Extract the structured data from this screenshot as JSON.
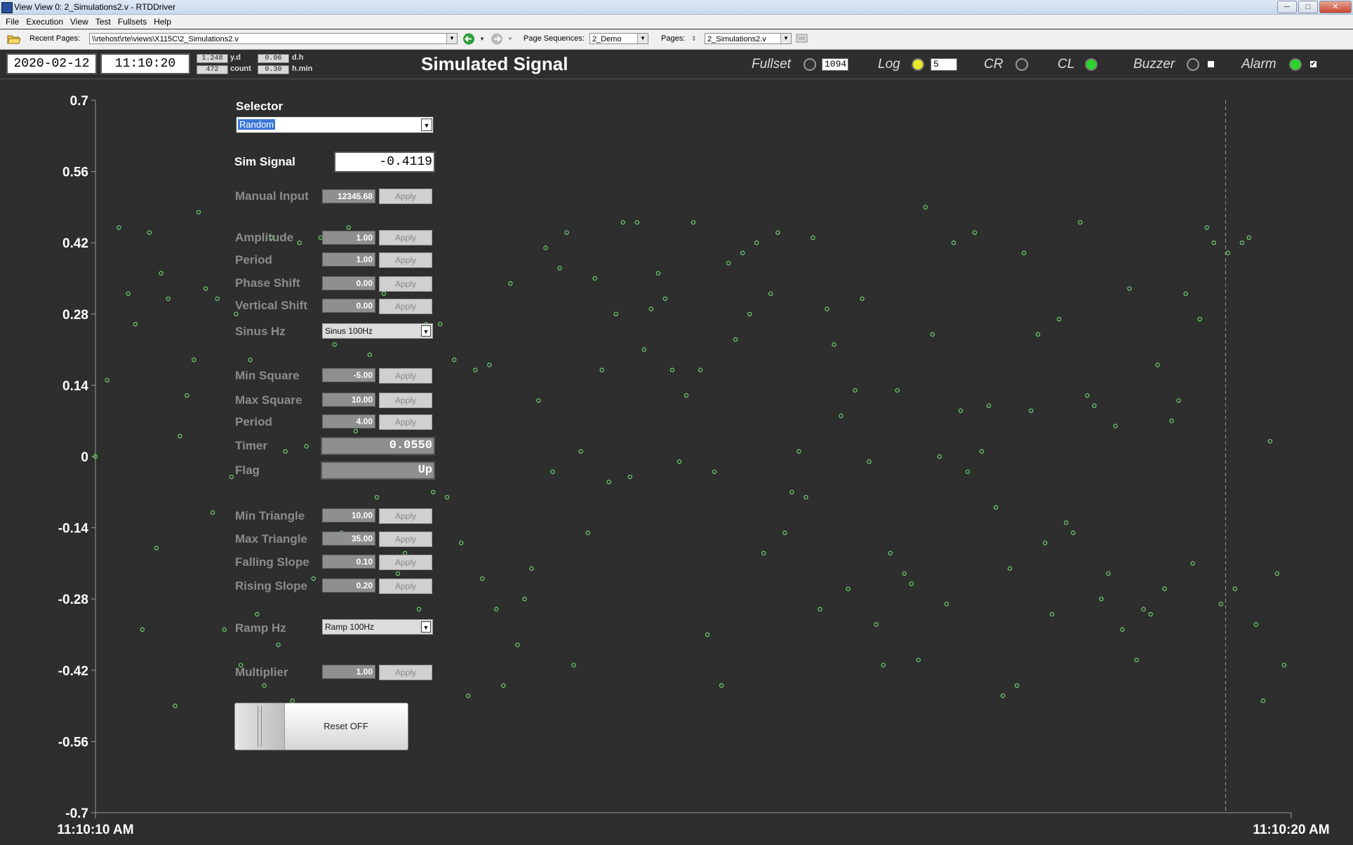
{
  "window": {
    "title": "View View 0: 2_Simulations2.v - RTDDriver",
    "buttons": [
      "─",
      "□",
      "✕"
    ]
  },
  "menubar": {
    "items": [
      "File",
      "Execution",
      "View",
      "Test",
      "Fullsets",
      "Help"
    ]
  },
  "toolbar": {
    "recent_pages_label": "Recent Pages:",
    "recent_pages_value": "\\\\rtehost\\rte\\views\\X115C\\2_Simulations2.v",
    "page_sequences_label": "Page Sequences:",
    "page_sequences_value": "2_Demo",
    "pages_label": "Pages:",
    "pages_value": "2_Simulations2.v"
  },
  "header": {
    "date": "2020-02-12",
    "time": "11:10:20",
    "yd_value": "1.248",
    "yd_label": "y.d",
    "count_value": "472",
    "count_label": "count",
    "dh_value": "0.06",
    "dh_label": "d.h",
    "hmin_value": "0.30",
    "hmin_label": "h.min",
    "title": "Simulated Signal",
    "fullset_label": "Fullset",
    "fullset_value": "1094",
    "log_label": "Log",
    "log_value": "5",
    "cr_label": "CR",
    "cl_label": "CL",
    "buzzer_label": "Buzzer",
    "alarm_label": "Alarm",
    "alarm_check": "✔",
    "colors": {
      "led_yellow": "#e8e82a",
      "led_green": "#2ad52a"
    }
  },
  "panel": {
    "selector_label": "Selector",
    "selector_value": "Random",
    "sim_signal_label": "Sim Signal",
    "sim_signal_value": "-0.4119",
    "manual_input_label": "Manual Input",
    "manual_input_value": "12345.68",
    "apply_label": "Apply",
    "amplitude_label": "Amplitude",
    "amplitude_value": "1.00",
    "period_label": "Period",
    "period_value": "1.00",
    "phase_shift_label": "Phase Shift",
    "phase_shift_value": "0.00",
    "vertical_shift_label": "Vertical Shift",
    "vertical_shift_value": "0.00",
    "sinus_hz_label": "Sinus Hz",
    "sinus_hz_value": "Sinus 100Hz",
    "min_square_label": "Min Square",
    "min_square_value": "-5.00",
    "max_square_label": "Max Square",
    "max_square_value": "10.00",
    "square_period_label": "Period",
    "square_period_value": "4.00",
    "timer_label": "Timer",
    "timer_value": "0.0550",
    "flag_label": "Flag",
    "flag_value": "Up",
    "min_triangle_label": "Min Triangle",
    "min_triangle_value": "10.00",
    "max_triangle_label": "Max Triangle",
    "max_triangle_value": "35.00",
    "falling_slope_label": "Falling Slope",
    "falling_slope_value": "0.10",
    "rising_slope_label": "Rising Slope",
    "rising_slope_value": "0.20",
    "ramp_hz_label": "Ramp Hz",
    "ramp_hz_value": "Ramp 100Hz",
    "multiplier_label": "Multiplier",
    "multiplier_value": "1.00",
    "reset_label": "Reset OFF"
  },
  "chart_data": {
    "type": "scatter",
    "title": "",
    "xlabel": "",
    "ylabel": "",
    "ylim": [
      -0.7,
      0.7
    ],
    "y_ticks": [
      "0.7",
      "0.56",
      "0.42",
      "0.28",
      "0.14",
      "0",
      "-0.14",
      "-0.28",
      "-0.42",
      "-0.56",
      "-0.7"
    ],
    "x_tick_labels": [
      "11:10:10 AM",
      "11:10:20 AM"
    ],
    "cursor_label": "",
    "marker_color": "#6fd46f",
    "series": [
      {
        "name": "",
        "points": [
          [
            0.0,
            0.0
          ],
          [
            0.05,
            0.15
          ],
          [
            0.1,
            0.45
          ],
          [
            0.14,
            0.32
          ],
          [
            0.17,
            0.26
          ],
          [
            0.2,
            -0.34
          ],
          [
            0.23,
            0.44
          ],
          [
            0.26,
            -0.18
          ],
          [
            0.28,
            0.36
          ],
          [
            0.31,
            0.31
          ],
          [
            0.34,
            -0.49
          ],
          [
            0.36,
            0.04
          ],
          [
            0.39,
            0.12
          ],
          [
            0.42,
            0.19
          ],
          [
            0.44,
            0.48
          ],
          [
            0.47,
            0.33
          ],
          [
            0.5,
            -0.11
          ],
          [
            0.52,
            0.31
          ],
          [
            0.55,
            -0.34
          ],
          [
            0.58,
            -0.04
          ],
          [
            0.6,
            0.28
          ],
          [
            0.62,
            -0.41
          ],
          [
            0.66,
            0.19
          ],
          [
            0.69,
            -0.31
          ],
          [
            0.72,
            -0.45
          ],
          [
            0.75,
            0.43
          ],
          [
            0.78,
            -0.37
          ],
          [
            0.81,
            0.01
          ],
          [
            0.84,
            -0.48
          ],
          [
            0.87,
            0.42
          ],
          [
            0.9,
            0.02
          ],
          [
            0.93,
            -0.24
          ],
          [
            0.96,
            0.43
          ],
          [
            0.99,
            -0.04
          ],
          [
            1.02,
            0.22
          ],
          [
            1.05,
            -0.15
          ],
          [
            1.08,
            0.45
          ],
          [
            1.11,
            0.05
          ],
          [
            1.14,
            -0.04
          ],
          [
            1.17,
            0.2
          ],
          [
            1.2,
            -0.08
          ],
          [
            1.23,
            0.32
          ],
          [
            1.26,
            0.44
          ],
          [
            1.29,
            -0.23
          ],
          [
            1.32,
            -0.19
          ],
          [
            1.35,
            0.12
          ],
          [
            1.38,
            -0.3
          ],
          [
            1.41,
            0.26
          ],
          [
            1.44,
            -0.07
          ],
          [
            1.47,
            0.26
          ],
          [
            1.5,
            -0.08
          ],
          [
            1.53,
            0.19
          ],
          [
            1.56,
            -0.17
          ],
          [
            1.59,
            -0.47
          ],
          [
            1.62,
            0.17
          ],
          [
            1.65,
            -0.24
          ],
          [
            1.68,
            0.18
          ],
          [
            1.71,
            -0.3
          ],
          [
            1.74,
            -0.45
          ],
          [
            1.77,
            0.34
          ],
          [
            1.8,
            -0.37
          ],
          [
            1.83,
            -0.28
          ],
          [
            1.86,
            -0.22
          ],
          [
            1.89,
            0.11
          ],
          [
            1.92,
            0.41
          ],
          [
            1.95,
            -0.03
          ],
          [
            1.98,
            0.37
          ],
          [
            2.01,
            0.44
          ],
          [
            2.04,
            -0.41
          ],
          [
            2.07,
            0.01
          ],
          [
            2.1,
            -0.15
          ],
          [
            2.13,
            0.35
          ],
          [
            2.16,
            0.17
          ],
          [
            2.19,
            -0.05
          ],
          [
            2.22,
            0.28
          ],
          [
            2.25,
            0.46
          ],
          [
            2.28,
            -0.04
          ],
          [
            2.31,
            0.46
          ],
          [
            2.34,
            0.21
          ],
          [
            2.37,
            0.29
          ],
          [
            2.4,
            0.36
          ],
          [
            2.43,
            0.31
          ],
          [
            2.46,
            0.17
          ],
          [
            2.49,
            -0.01
          ],
          [
            2.52,
            0.12
          ],
          [
            2.55,
            0.46
          ],
          [
            2.58,
            0.17
          ],
          [
            2.61,
            -0.35
          ],
          [
            2.64,
            -0.03
          ],
          [
            2.67,
            -0.45
          ],
          [
            2.7,
            0.38
          ],
          [
            2.73,
            0.23
          ],
          [
            2.76,
            0.4
          ],
          [
            2.79,
            0.28
          ],
          [
            2.82,
            0.42
          ],
          [
            2.85,
            -0.19
          ],
          [
            2.88,
            0.32
          ],
          [
            2.91,
            0.44
          ],
          [
            2.94,
            -0.15
          ],
          [
            2.97,
            -0.07
          ],
          [
            3.0,
            0.01
          ],
          [
            3.03,
            -0.08
          ],
          [
            3.06,
            0.43
          ],
          [
            3.09,
            -0.3
          ],
          [
            3.12,
            0.29
          ],
          [
            3.15,
            0.22
          ],
          [
            3.18,
            0.08
          ],
          [
            3.21,
            -0.26
          ],
          [
            3.24,
            0.13
          ],
          [
            3.27,
            0.31
          ],
          [
            3.3,
            -0.01
          ],
          [
            3.33,
            -0.33
          ],
          [
            3.36,
            -0.41
          ],
          [
            3.39,
            -0.19
          ],
          [
            3.42,
            0.13
          ],
          [
            3.45,
            -0.23
          ],
          [
            3.48,
            -0.25
          ],
          [
            3.51,
            -0.4
          ],
          [
            3.54,
            0.49
          ],
          [
            3.57,
            0.24
          ],
          [
            3.6,
            0.0
          ],
          [
            3.63,
            -0.29
          ],
          [
            3.66,
            0.42
          ],
          [
            3.69,
            0.09
          ],
          [
            3.72,
            -0.03
          ],
          [
            3.75,
            0.44
          ],
          [
            3.78,
            0.01
          ],
          [
            3.81,
            0.1
          ],
          [
            3.84,
            -0.1
          ],
          [
            3.87,
            -0.47
          ],
          [
            3.9,
            -0.22
          ],
          [
            3.93,
            -0.45
          ],
          [
            3.96,
            0.4
          ],
          [
            3.99,
            0.09
          ],
          [
            4.02,
            0.24
          ],
          [
            4.05,
            -0.17
          ],
          [
            4.08,
            -0.31
          ],
          [
            4.11,
            0.27
          ],
          [
            4.14,
            -0.13
          ],
          [
            4.17,
            -0.15
          ],
          [
            4.2,
            0.46
          ],
          [
            4.23,
            0.12
          ],
          [
            4.26,
            0.1
          ],
          [
            4.29,
            -0.28
          ],
          [
            4.32,
            -0.23
          ],
          [
            4.35,
            0.06
          ],
          [
            4.38,
            -0.34
          ],
          [
            4.41,
            0.33
          ],
          [
            4.44,
            -0.4
          ],
          [
            4.47,
            -0.3
          ],
          [
            4.5,
            -0.31
          ],
          [
            4.53,
            0.18
          ],
          [
            4.56,
            -0.26
          ],
          [
            4.59,
            0.07
          ],
          [
            4.62,
            0.11
          ],
          [
            4.65,
            0.32
          ],
          [
            4.68,
            -0.21
          ],
          [
            4.71,
            0.27
          ],
          [
            4.74,
            0.45
          ],
          [
            4.77,
            0.42
          ],
          [
            4.8,
            -0.29
          ],
          [
            4.83,
            0.4
          ],
          [
            4.86,
            -0.26
          ],
          [
            4.89,
            0.42
          ],
          [
            4.92,
            0.43
          ],
          [
            4.95,
            -0.33
          ],
          [
            4.98,
            -0.48
          ],
          [
            5.01,
            0.03
          ],
          [
            5.04,
            -0.23
          ],
          [
            5.07,
            -0.41
          ]
        ]
      }
    ],
    "xlim": [
      0,
      5.1
    ],
    "cursor_x": 4.82
  }
}
